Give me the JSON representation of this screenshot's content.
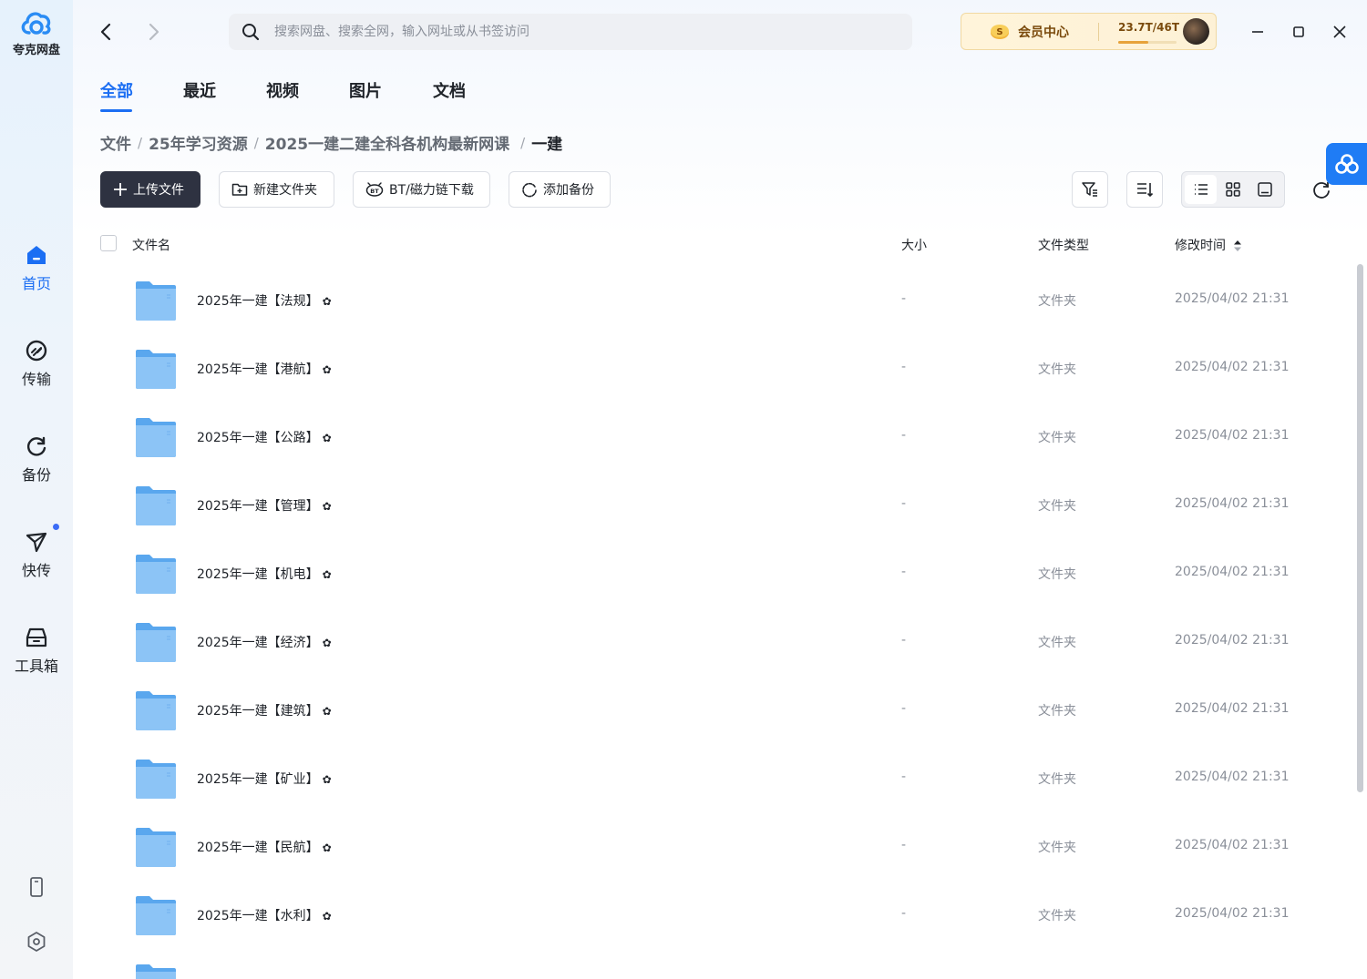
{
  "app": {
    "name": "夸克网盘",
    "brand_color": "#1b6ef3"
  },
  "sidebar": {
    "items": [
      {
        "label": "首页",
        "icon": "home-icon",
        "active": true
      },
      {
        "label": "传输",
        "icon": "transfer-icon"
      },
      {
        "label": "备份",
        "icon": "backup-icon"
      },
      {
        "label": "快传",
        "icon": "send-icon"
      },
      {
        "label": "工具箱",
        "icon": "toolbox-icon"
      }
    ],
    "bottom": [
      "phone-icon",
      "settings-icon"
    ]
  },
  "topbar": {
    "search_placeholder": "搜索网盘、搜索全网，输入网址或从书签访问",
    "vip_label": "会员中心",
    "storage": "23.7T/46T",
    "storage_fraction": 0.515
  },
  "tabs": [
    "全部",
    "最近",
    "视频",
    "图片",
    "文档"
  ],
  "breadcrumb": [
    "文件",
    "25年学习资源",
    "2025一建二建全科各机构最新网课",
    "一建"
  ],
  "toolbar": {
    "upload": "上传文件",
    "new_folder": "新建文件夹",
    "bt_download": "BT/磁力链下载",
    "add_backup": "添加备份"
  },
  "table": {
    "headers": {
      "name": "文件名",
      "size": "大小",
      "type": "文件类型",
      "mtime": "修改时间"
    },
    "rows": [
      {
        "name": "2025年一建【法规】",
        "size": "-",
        "type": "文件夹",
        "mtime": "2025/04/02 21:31"
      },
      {
        "name": "2025年一建【港航】",
        "size": "-",
        "type": "文件夹",
        "mtime": "2025/04/02 21:31"
      },
      {
        "name": "2025年一建【公路】",
        "size": "-",
        "type": "文件夹",
        "mtime": "2025/04/02 21:31"
      },
      {
        "name": "2025年一建【管理】",
        "size": "-",
        "type": "文件夹",
        "mtime": "2025/04/02 21:31"
      },
      {
        "name": "2025年一建【机电】",
        "size": "-",
        "type": "文件夹",
        "mtime": "2025/04/02 21:31"
      },
      {
        "name": "2025年一建【经济】",
        "size": "-",
        "type": "文件夹",
        "mtime": "2025/04/02 21:31"
      },
      {
        "name": "2025年一建【建筑】",
        "size": "-",
        "type": "文件夹",
        "mtime": "2025/04/02 21:31"
      },
      {
        "name": "2025年一建【矿业】",
        "size": "-",
        "type": "文件夹",
        "mtime": "2025/04/02 21:31"
      },
      {
        "name": "2025年一建【民航】",
        "size": "-",
        "type": "文件夹",
        "mtime": "2025/04/02 21:31"
      },
      {
        "name": "2025年一建【水利】",
        "size": "-",
        "type": "文件夹",
        "mtime": "2025/04/02 21:31"
      }
    ],
    "star_glyph": "✿"
  }
}
